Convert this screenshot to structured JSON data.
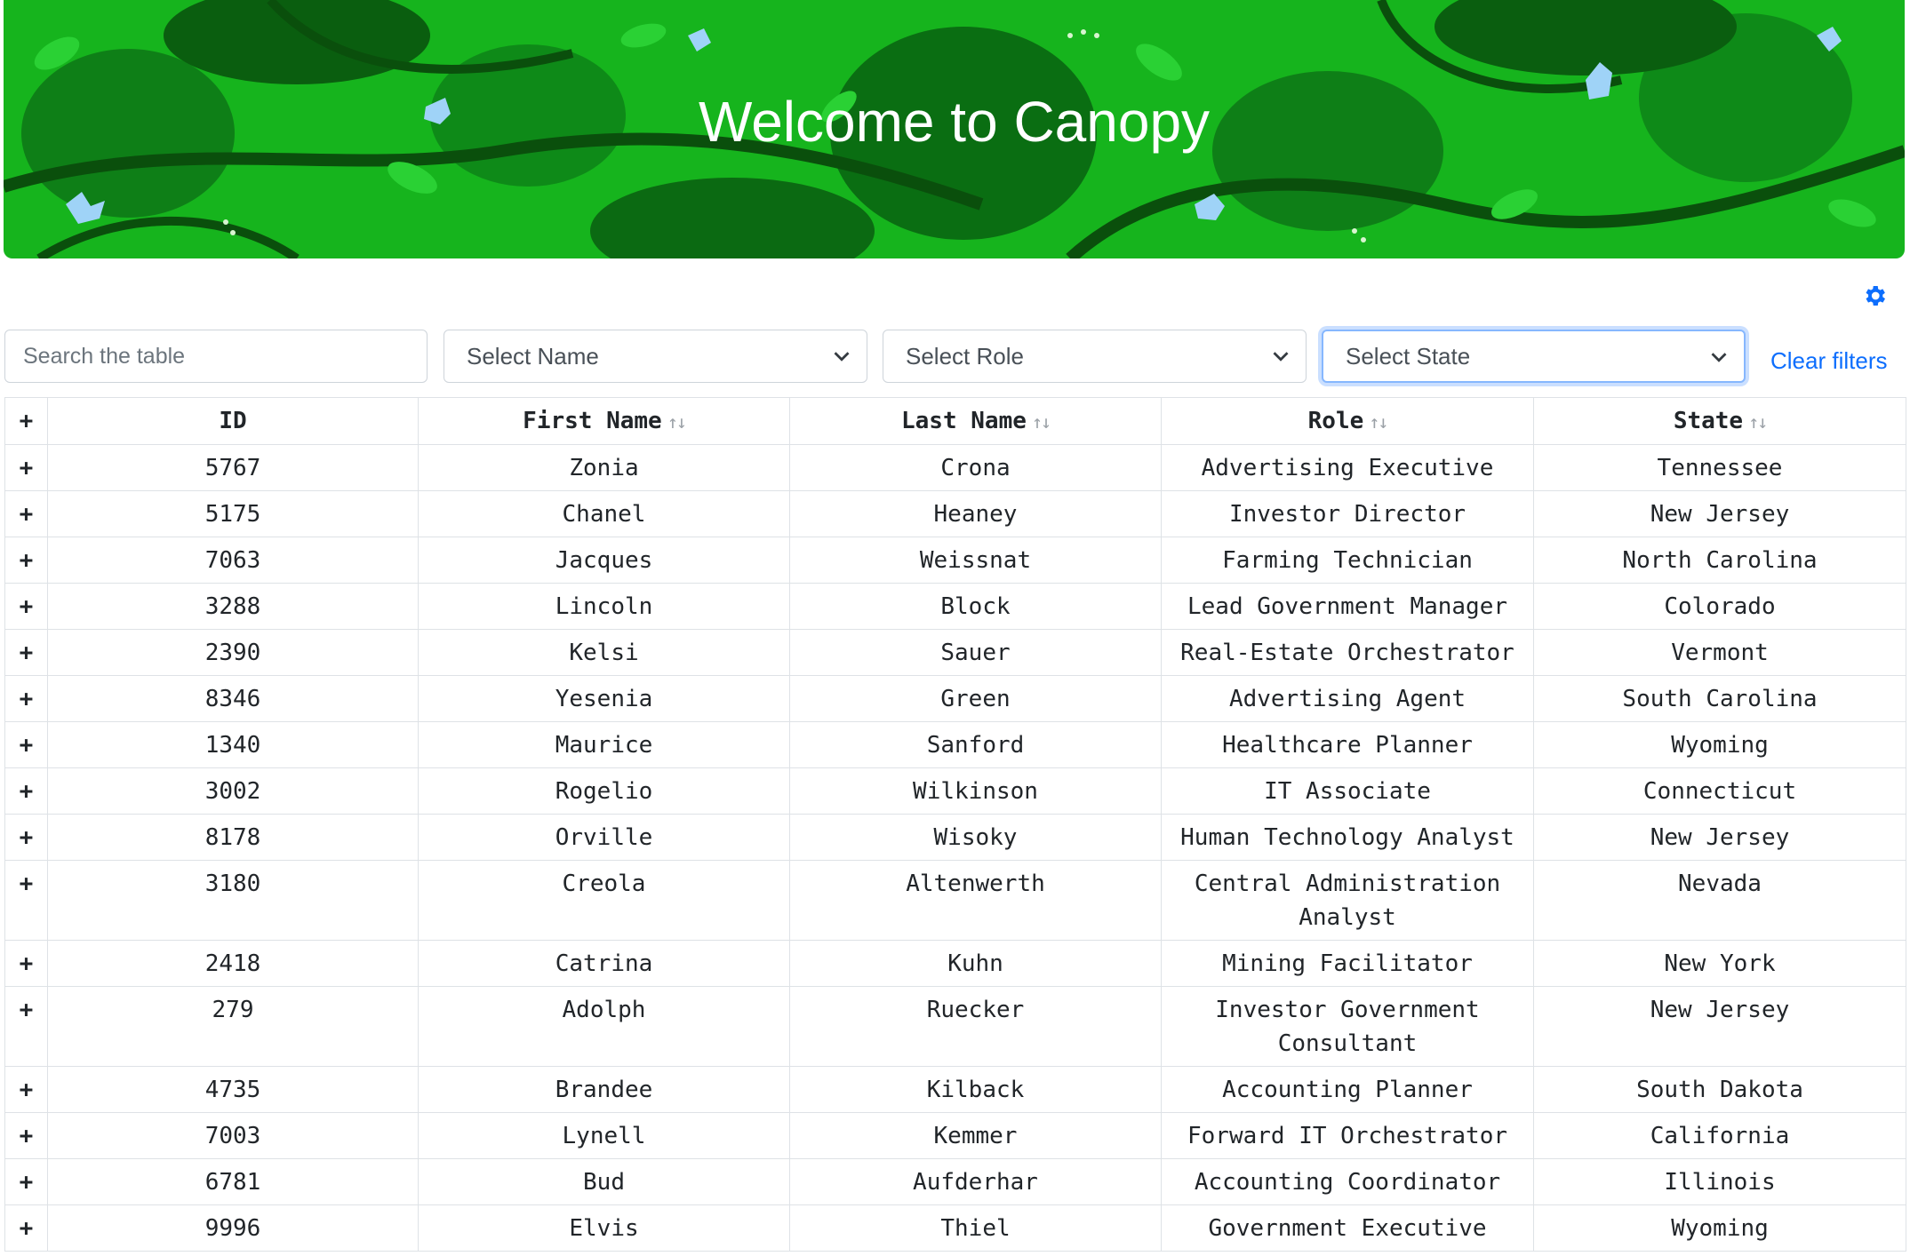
{
  "banner": {
    "title": "Welcome to Canopy"
  },
  "toolbar": {
    "search_placeholder": "Search the table",
    "name_select": "Select Name",
    "role_select": "Select Role",
    "state_select": "Select State",
    "clear_filters": "Clear filters"
  },
  "table": {
    "expand_header": "+",
    "headers": [
      "ID",
      "First Name",
      "Last Name",
      "Role",
      "State"
    ],
    "sort_indicator": "↑↓",
    "rows": [
      {
        "expand": "+",
        "id": "5767",
        "first": "Zonia",
        "last": "Crona",
        "role": "Advertising Executive",
        "state": "Tennessee"
      },
      {
        "expand": "+",
        "id": "5175",
        "first": "Chanel",
        "last": "Heaney",
        "role": "Investor Director",
        "state": "New Jersey"
      },
      {
        "expand": "+",
        "id": "7063",
        "first": "Jacques",
        "last": "Weissnat",
        "role": "Farming Technician",
        "state": "North Carolina"
      },
      {
        "expand": "+",
        "id": "3288",
        "first": "Lincoln",
        "last": "Block",
        "role": "Lead Government Manager",
        "state": "Colorado"
      },
      {
        "expand": "+",
        "id": "2390",
        "first": "Kelsi",
        "last": "Sauer",
        "role": "Real-Estate Orchestrator",
        "state": "Vermont"
      },
      {
        "expand": "+",
        "id": "8346",
        "first": "Yesenia",
        "last": "Green",
        "role": "Advertising Agent",
        "state": "South Carolina"
      },
      {
        "expand": "+",
        "id": "1340",
        "first": "Maurice",
        "last": "Sanford",
        "role": "Healthcare Planner",
        "state": "Wyoming"
      },
      {
        "expand": "+",
        "id": "3002",
        "first": "Rogelio",
        "last": "Wilkinson",
        "role": "IT Associate",
        "state": "Connecticut"
      },
      {
        "expand": "+",
        "id": "8178",
        "first": "Orville",
        "last": "Wisoky",
        "role": "Human Technology Analyst",
        "state": "New Jersey"
      },
      {
        "expand": "+",
        "id": "3180",
        "first": "Creola",
        "last": "Altenwerth",
        "role": "Central Administration Analyst",
        "state": "Nevada"
      },
      {
        "expand": "+",
        "id": "2418",
        "first": "Catrina",
        "last": "Kuhn",
        "role": "Mining Facilitator",
        "state": "New York"
      },
      {
        "expand": "+",
        "id": "279",
        "first": "Adolph",
        "last": "Ruecker",
        "role": "Investor Government Consultant",
        "state": "New Jersey"
      },
      {
        "expand": "+",
        "id": "4735",
        "first": "Brandee",
        "last": "Kilback",
        "role": "Accounting Planner",
        "state": "South Dakota"
      },
      {
        "expand": "+",
        "id": "7003",
        "first": "Lynell",
        "last": "Kemmer",
        "role": "Forward IT Orchestrator",
        "state": "California"
      },
      {
        "expand": "+",
        "id": "6781",
        "first": "Bud",
        "last": "Aufderhar",
        "role": "Accounting Coordinator",
        "state": "Illinois"
      },
      {
        "expand": "+",
        "id": "9996",
        "first": "Elvis",
        "last": "Thiel",
        "role": "Government Executive",
        "state": "Wyoming"
      }
    ]
  },
  "colors": {
    "accent": "#0d6efd",
    "banner_green": "#18b41e"
  },
  "icons": {
    "settings": "gear-icon",
    "dropdown": "chevron-down-icon"
  }
}
